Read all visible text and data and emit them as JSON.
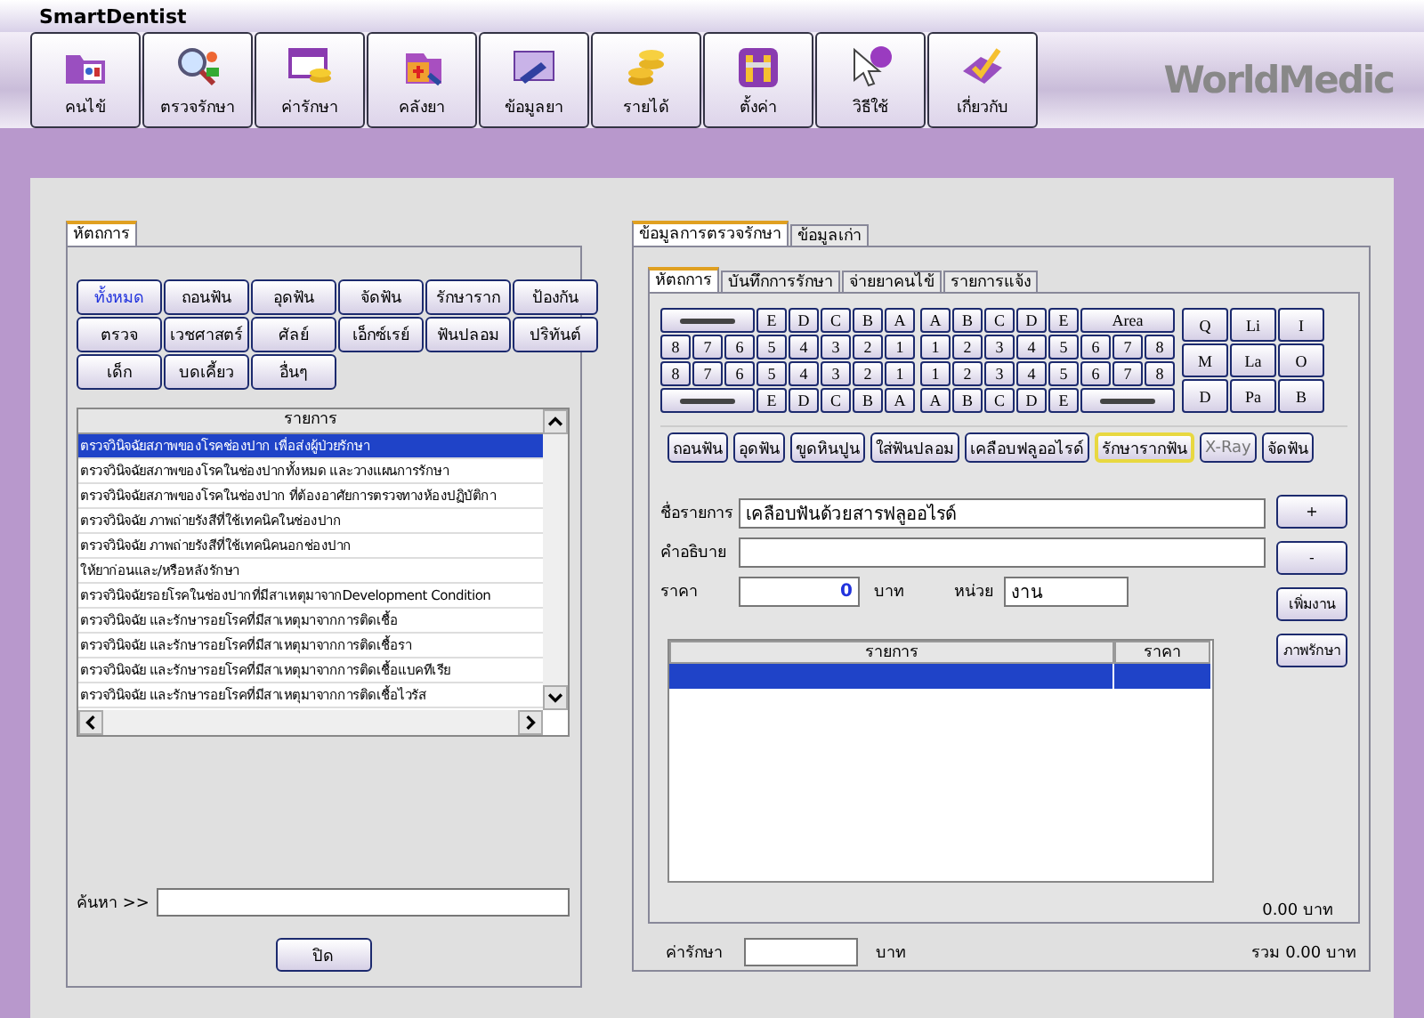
{
  "window": {
    "title": "SmartDentist"
  },
  "toolbar": [
    {
      "label": "คนไข้"
    },
    {
      "label": "ตรวจรักษา"
    },
    {
      "label": "ค่ารักษา"
    },
    {
      "label": "คลังยา"
    },
    {
      "label": "ข้อมูลยา"
    },
    {
      "label": "รายได้"
    },
    {
      "label": "ตั้งค่า"
    },
    {
      "label": "วิธีใช้"
    },
    {
      "label": "เกี่ยวกับ"
    }
  ],
  "logo": "WorldMedic",
  "left": {
    "tabs": [
      {
        "label": "หัตถการ",
        "selected": true
      }
    ],
    "categories": [
      {
        "label": "ทั้งหมด",
        "selected": true
      },
      {
        "label": "ถอนฟัน",
        "selected": false
      },
      {
        "label": "อุดฟัน",
        "selected": false
      },
      {
        "label": "จัดฟัน",
        "selected": false
      },
      {
        "label": "รักษาราก",
        "selected": false
      },
      {
        "label": "ป้องกัน",
        "selected": false
      },
      {
        "label": "ตรวจ",
        "selected": false
      },
      {
        "label": "เวชศาสตร์",
        "selected": false
      },
      {
        "label": "ศัลย์",
        "selected": false
      },
      {
        "label": "เอ็กซ์เรย์",
        "selected": false
      },
      {
        "label": "ฟันปลอม",
        "selected": false
      },
      {
        "label": "ปริทันต์",
        "selected": false
      },
      {
        "label": "เด็ก",
        "selected": false
      },
      {
        "label": "บดเคี้ยว",
        "selected": false
      },
      {
        "label": "อื่นๆ",
        "selected": false
      }
    ],
    "list": {
      "column": "รายการ",
      "rows": [
        {
          "text": "ตรวจวินิจฉัยสภาพของโรคช่องปาก เพื่อส่งผู้ป่วยรักษา",
          "selected": true
        },
        {
          "text": "ตรวจวินิจฉัยสภาพของโรคในช่องปากทั้งหมด และวางแผนการรักษา",
          "selected": false
        },
        {
          "text": "ตรวจวินิจฉัยสภาพของโรคในช่องปาก ที่ต้องอาศัยการตรวจทางห้องปฏิบัติกา",
          "selected": false
        },
        {
          "text": "ตรวจวินิจฉัย ภาพถ่ายรังสีที่ใช้เทคนิคในช่องปาก",
          "selected": false
        },
        {
          "text": "ตรวจวินิจฉัย ภาพถ่ายรังสีที่ใช้เทคนิคนอกช่องปาก",
          "selected": false
        },
        {
          "text": "ให้ยาก่อนและ/หรือหลังรักษา",
          "selected": false
        },
        {
          "text": "ตรวจวินิจฉัยรอยโรคในช่องปากที่มีสาเหตุมาจากDevelopment Condition",
          "selected": false
        },
        {
          "text": "ตรวจวินิจฉัย และรักษารอยโรคที่มีสาเหตุมาจากการติดเชื้อ",
          "selected": false
        },
        {
          "text": "ตรวจวินิจฉัย และรักษารอยโรคที่มีสาเหตุมาจากการติดเชื้อรา",
          "selected": false
        },
        {
          "text": "ตรวจวินิจฉัย และรักษารอยโรคที่มีสาเหตุมาจากการติดเชื้อแบคทีเรีย",
          "selected": false
        },
        {
          "text": "ตรวจวินิจฉัย และรักษารอยโรคที่มีสาเหตุมาจากการติดเชื้อไวรัส",
          "selected": false
        }
      ]
    },
    "search": {
      "label": "ค้นหา >>"
    },
    "close_button": "ปิด"
  },
  "right": {
    "tabs": [
      {
        "label": "ข้อมูลการตรวจรักษา",
        "selected": true
      },
      {
        "label": "ข้อมูลเก่า",
        "selected": false
      }
    ],
    "subtabs": [
      {
        "label": "หัตถการ",
        "selected": true
      },
      {
        "label": "บันทึกการรักษา",
        "selected": false
      },
      {
        "label": "จ่ายยาคนไข้",
        "selected": false
      },
      {
        "label": "รายการแจ้ง",
        "selected": false
      }
    ],
    "tooth_chart": {
      "left": [
        [
          {
            "kind": "bar"
          },
          {
            "kind": "key",
            "label": "E"
          },
          {
            "kind": "key",
            "label": "D"
          },
          {
            "kind": "key",
            "label": "C"
          },
          {
            "kind": "key",
            "label": "B"
          },
          {
            "kind": "key",
            "label": "A"
          }
        ],
        [
          {
            "kind": "key",
            "label": "8"
          },
          {
            "kind": "key",
            "label": "7"
          },
          {
            "kind": "key",
            "label": "6"
          },
          {
            "kind": "key",
            "label": "5"
          },
          {
            "kind": "key",
            "label": "4"
          },
          {
            "kind": "key",
            "label": "3"
          },
          {
            "kind": "key",
            "label": "2"
          },
          {
            "kind": "key",
            "label": "1"
          }
        ],
        [
          {
            "kind": "key",
            "label": "8"
          },
          {
            "kind": "key",
            "label": "7"
          },
          {
            "kind": "key",
            "label": "6"
          },
          {
            "kind": "key",
            "label": "5"
          },
          {
            "kind": "key",
            "label": "4"
          },
          {
            "kind": "key",
            "label": "3"
          },
          {
            "kind": "key",
            "label": "2"
          },
          {
            "kind": "key",
            "label": "1"
          }
        ],
        [
          {
            "kind": "bar"
          },
          {
            "kind": "key",
            "label": "E"
          },
          {
            "kind": "key",
            "label": "D"
          },
          {
            "kind": "key",
            "label": "C"
          },
          {
            "kind": "key",
            "label": "B"
          },
          {
            "kind": "key",
            "label": "A"
          }
        ]
      ],
      "right": [
        [
          {
            "kind": "key",
            "label": "A"
          },
          {
            "kind": "key",
            "label": "B"
          },
          {
            "kind": "key",
            "label": "C"
          },
          {
            "kind": "key",
            "label": "D"
          },
          {
            "kind": "key",
            "label": "E"
          },
          {
            "kind": "wide",
            "label": "Area"
          }
        ],
        [
          {
            "kind": "key",
            "label": "1"
          },
          {
            "kind": "key",
            "label": "2"
          },
          {
            "kind": "key",
            "label": "3"
          },
          {
            "kind": "key",
            "label": "4"
          },
          {
            "kind": "key",
            "label": "5"
          },
          {
            "kind": "key",
            "label": "6"
          },
          {
            "kind": "key",
            "label": "7"
          },
          {
            "kind": "key",
            "label": "8"
          }
        ],
        [
          {
            "kind": "key",
            "label": "1"
          },
          {
            "kind": "key",
            "label": "2"
          },
          {
            "kind": "key",
            "label": "3"
          },
          {
            "kind": "key",
            "label": "4"
          },
          {
            "kind": "key",
            "label": "5"
          },
          {
            "kind": "key",
            "label": "6"
          },
          {
            "kind": "key",
            "label": "7"
          },
          {
            "kind": "key",
            "label": "8"
          }
        ],
        [
          {
            "kind": "key",
            "label": "A"
          },
          {
            "kind": "key",
            "label": "B"
          },
          {
            "kind": "key",
            "label": "C"
          },
          {
            "kind": "key",
            "label": "D"
          },
          {
            "kind": "key",
            "label": "E"
          },
          {
            "kind": "bar"
          }
        ]
      ],
      "surfaces": [
        "Q",
        "Li",
        "I",
        "M",
        "La",
        "O",
        "D",
        "Pa",
        "B"
      ]
    },
    "procedures": [
      {
        "label": "ถอนฟัน",
        "selected": false,
        "disabled": false
      },
      {
        "label": "อุดฟัน",
        "selected": false,
        "disabled": false
      },
      {
        "label": "ขูดหินปูน",
        "selected": false,
        "disabled": false
      },
      {
        "label": "ใส่ฟันปลอม",
        "selected": false,
        "disabled": false
      },
      {
        "label": "เคลือบฟลูออไรด์",
        "selected": false,
        "disabled": false
      },
      {
        "label": "รักษารากฟัน",
        "selected": true,
        "disabled": false
      },
      {
        "label": "X-Ray",
        "selected": false,
        "disabled": true
      },
      {
        "label": "จัดฟัน",
        "selected": false,
        "disabled": false
      }
    ],
    "form": {
      "name": {
        "label": "ชื่อรายการ",
        "value": "เคลือบฟันด้วยสารฟลูออไรด์"
      },
      "description": {
        "label": "คำอธิบาย"
      },
      "price": {
        "label": "ราคา",
        "value": "0",
        "unit": "บาท"
      },
      "unit": {
        "label": "หน่วย",
        "value": "งาน"
      }
    },
    "side_buttons": [
      "+",
      "-",
      "เพิ่มงาน",
      "ภาพรักษา"
    ],
    "table": {
      "columns": [
        "รายการ",
        "ราคา"
      ],
      "rows": [
        {
          "selected": true
        }
      ]
    },
    "total": "0.00 บาท",
    "fee": {
      "label": "ค่ารักษา",
      "unit": "บาท"
    },
    "grand_total": "รวม 0.00 บาท"
  }
}
